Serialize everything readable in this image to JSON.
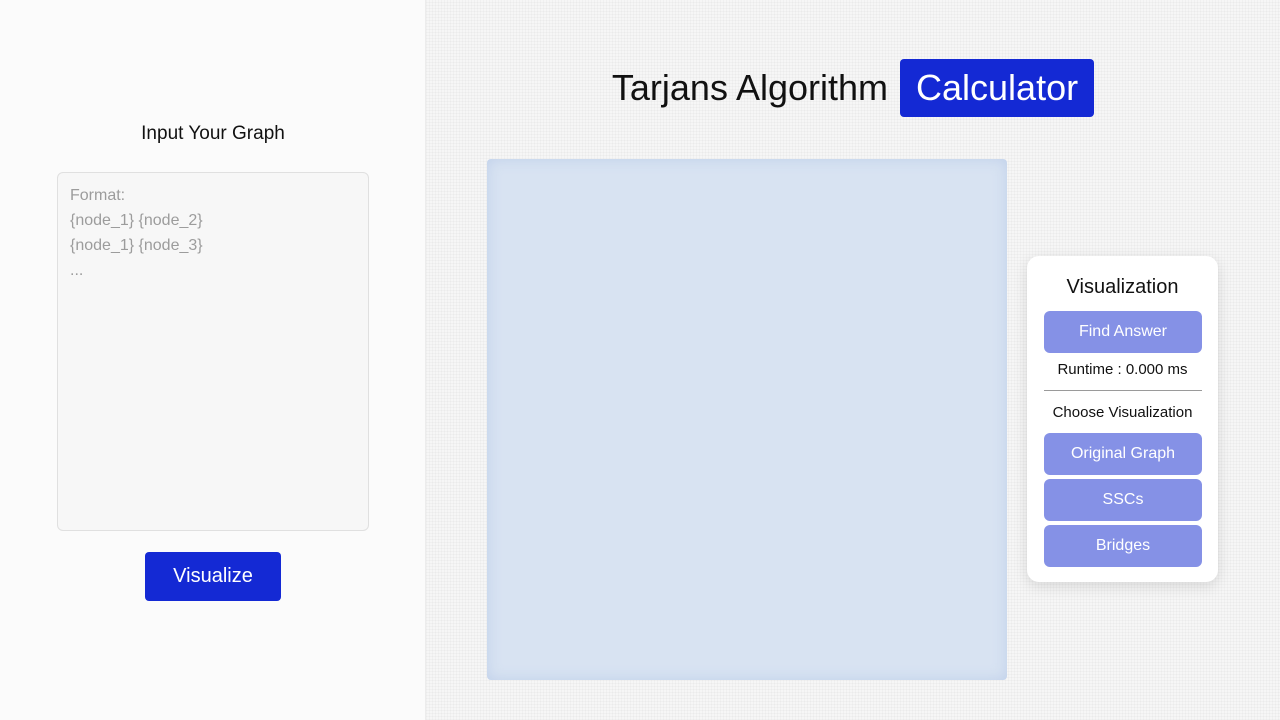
{
  "left_panel": {
    "title": "Input Your Graph",
    "textarea": {
      "placeholder": "Format:\n{node_1} {node_2}\n{node_1} {node_3}\n...",
      "value": ""
    },
    "visualize_label": "Visualize"
  },
  "header": {
    "title": "Tarjans Algorithm",
    "highlight": "Calculator"
  },
  "viz_panel": {
    "title": "Visualization",
    "find_answer_label": "Find Answer",
    "runtime_text": "Runtime : 0.000 ms",
    "choose_label": "Choose Visualization",
    "options": {
      "original_graph": "Original Graph",
      "sscs": "SSCs",
      "bridges": "Bridges"
    }
  },
  "colors": {
    "accent": "#1429d4",
    "button_light": "#8591e6",
    "canvas_bg": "#d8e3f2"
  }
}
